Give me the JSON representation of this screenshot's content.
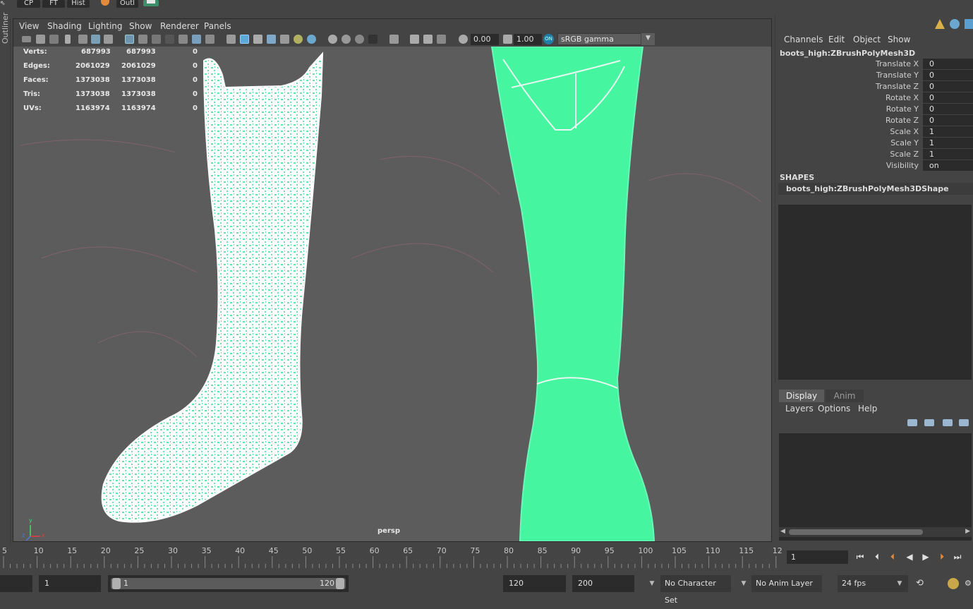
{
  "shelf": {
    "cp": "CP",
    "ft": "FT",
    "hist": "Hist",
    "outl": "Outl"
  },
  "outliner": {
    "label": "Outliner"
  },
  "viewport": {
    "menus": [
      "View",
      "Shading",
      "Lighting",
      "Show",
      "Renderer",
      "Panels"
    ],
    "exposure": "0.00",
    "gamma_value": "1.00",
    "color_space": "sRGB gamma",
    "color_mgmt_badge": "ON",
    "camera": "persp",
    "hud": [
      {
        "label": "Verts:",
        "total": "687993",
        "selected": "687993",
        "third": "0"
      },
      {
        "label": "Edges:",
        "total": "2061029",
        "selected": "2061029",
        "third": "0"
      },
      {
        "label": "Faces:",
        "total": "1373038",
        "selected": "1373038",
        "third": "0"
      },
      {
        "label": "Tris:",
        "total": "1373038",
        "selected": "1373038",
        "third": "0"
      },
      {
        "label": "UVs:",
        "total": "1163974",
        "selected": "1163974",
        "third": "0"
      }
    ],
    "axis": {
      "y": "y",
      "x": "x",
      "z": "z"
    }
  },
  "channel_box": {
    "menus": [
      "Channels",
      "Edit",
      "Object",
      "Show"
    ],
    "object_name": "boots_high:ZBrushPolyMesh3D",
    "attributes": [
      {
        "label": "Translate X",
        "value": "0"
      },
      {
        "label": "Translate Y",
        "value": "0"
      },
      {
        "label": "Translate Z",
        "value": "0"
      },
      {
        "label": "Rotate X",
        "value": "0"
      },
      {
        "label": "Rotate Y",
        "value": "0"
      },
      {
        "label": "Rotate Z",
        "value": "0"
      },
      {
        "label": "Scale X",
        "value": "1"
      },
      {
        "label": "Scale Y",
        "value": "1"
      },
      {
        "label": "Scale Z",
        "value": "1"
      },
      {
        "label": "Visibility",
        "value": "on"
      }
    ],
    "shapes_header": "SHAPES",
    "shape_name": "boots_high:ZBrushPolyMesh3DShape"
  },
  "layer_editor": {
    "tabs": [
      "Display",
      "Anim"
    ],
    "active_tab": "Display",
    "menus": [
      "Layers",
      "Options",
      "Help"
    ]
  },
  "time_slider": {
    "ticks": [
      "5",
      "10",
      "15",
      "20",
      "25",
      "30",
      "35",
      "40",
      "45",
      "50",
      "55",
      "60",
      "65",
      "70",
      "75",
      "80",
      "85",
      "90",
      "95",
      "100",
      "105",
      "110",
      "115",
      "12"
    ],
    "current_frame": "1"
  },
  "range_slider": {
    "start": "1",
    "range_start": "1",
    "range_end": "120",
    "end": "120",
    "anim_end": "200",
    "character_set": "No Character Set",
    "anim_layer": "No Anim Layer",
    "fps": "24 fps"
  },
  "colors": {
    "mesh_green": "#45f5a0",
    "wire_white": "#ffffff",
    "viewport_bg": "#5c5c5c",
    "panel_bg": "#444444",
    "field_bg": "#2b2b2b",
    "accent_blue": "#1f7fa6"
  }
}
